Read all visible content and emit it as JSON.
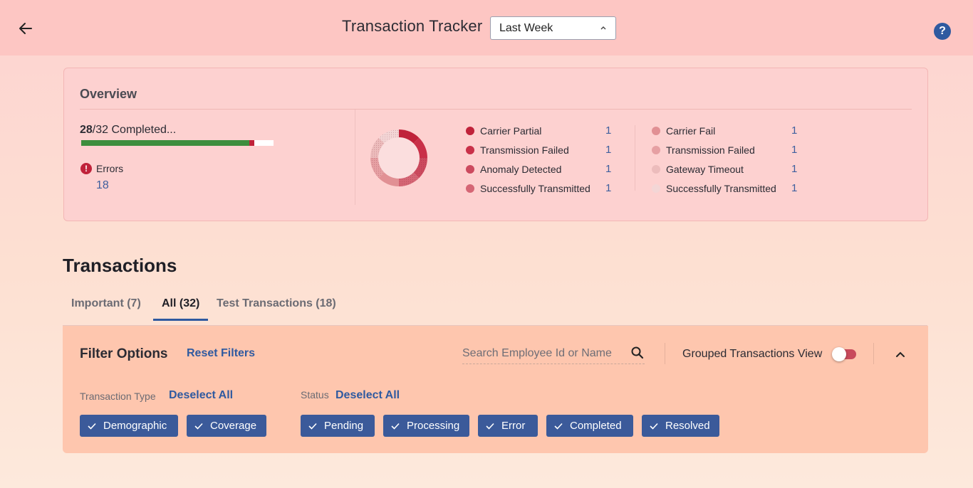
{
  "header": {
    "title": "Transaction Tracker",
    "period": {
      "selected": "Last Week"
    },
    "help_label": "?"
  },
  "overview": {
    "title": "Overview",
    "completed": {
      "done": "28",
      "rest": "/32 Completed..."
    },
    "progress": {
      "completed": 28,
      "errors": 1,
      "total": 32
    },
    "errors": {
      "label": "Errors",
      "count": "18",
      "icon_glyph": "!"
    },
    "donut": {
      "slices": [
        {
          "value": 1,
          "color": "#c0223a",
          "texture": "solid"
        },
        {
          "value": 1,
          "color": "#c93048",
          "texture": "solid"
        },
        {
          "value": 1,
          "color": "#cc4a5e",
          "texture": "dotted"
        },
        {
          "value": 1,
          "color": "#d56675",
          "texture": "dotted"
        },
        {
          "value": 1,
          "color": "#e19094",
          "texture": "solid"
        },
        {
          "value": 1,
          "color": "#e6a0a3",
          "texture": "dotted"
        },
        {
          "value": 1,
          "color": "#ecbcbc",
          "texture": "dotted"
        },
        {
          "value": 1,
          "color": "#f3d6d6",
          "texture": "dotted"
        }
      ]
    },
    "legend_left": [
      {
        "label": "Carrier Partial",
        "value": "1",
        "color": "#c0223a"
      },
      {
        "label": "Transmission Failed",
        "value": "1",
        "color": "#c93048"
      },
      {
        "label": "Anomaly Detected",
        "value": "1",
        "color": "#cc4a5e"
      },
      {
        "label": "Successfully Transmitted",
        "value": "1",
        "color": "#d56675"
      }
    ],
    "legend_right": [
      {
        "label": "Carrier Fail",
        "value": "1",
        "color": "#e19094"
      },
      {
        "label": "Transmission Failed",
        "value": "1",
        "color": "#e6a0a3"
      },
      {
        "label": "Gateway Timeout",
        "value": "1",
        "color": "#ecbcbc"
      },
      {
        "label": "Successfully Transmitted",
        "value": "1",
        "color": "#f3d6d6"
      }
    ]
  },
  "transactions": {
    "title": "Transactions",
    "tabs": [
      {
        "label": "Important (7)",
        "active": false
      },
      {
        "label": "All (32)",
        "active": true
      },
      {
        "label": "Test Transactions (18)",
        "active": false
      }
    ]
  },
  "filters": {
    "title": "Filter Options",
    "reset_label": "Reset Filters",
    "search_placeholder": "Search Employee Id or Name",
    "grouped_label": "Grouped Transactions View",
    "grouped_on": false,
    "type_group": {
      "label": "Transaction Type",
      "deselect_label": "Deselect All",
      "chips": [
        "Demographic",
        "Coverage"
      ]
    },
    "status_group": {
      "label": "Status",
      "deselect_label": "Deselect All",
      "chips": [
        "Pending",
        "Processing",
        "Error",
        "Completed",
        "Resolved"
      ]
    }
  },
  "colors": {
    "accent": "#2f5aa0",
    "error": "#c0223a",
    "success": "#3e8e3e",
    "chip": "#3b5a9a"
  },
  "icons": {
    "back": "arrow-left-icon",
    "help": "help-circle-icon",
    "search": "search-icon",
    "collapse": "chevron-up-icon",
    "check": "check-icon"
  }
}
